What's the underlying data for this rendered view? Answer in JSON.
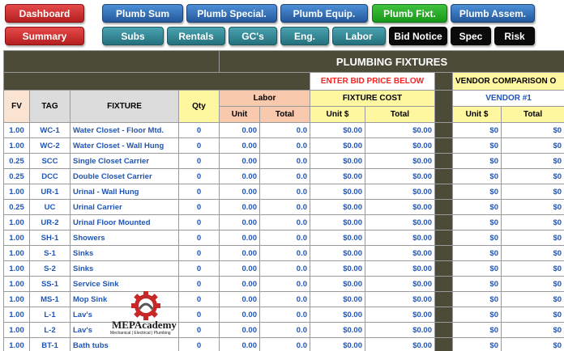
{
  "nav": {
    "row1": [
      "Dashboard",
      "Plumb Sum",
      "Plumb Special.",
      "Plumb Equip.",
      "Plumb Fixt.",
      "Plumb Assem."
    ],
    "row2": [
      "Summary",
      "Subs",
      "Rentals",
      "GC's",
      "Eng.",
      "Labor",
      "Bid Notice",
      "Spec",
      "Risk"
    ]
  },
  "sheet": {
    "title": "PLUMBING FIXTURES",
    "bid_note": "ENTER BID PRICE BELOW",
    "vendor_comparison": "VENDOR COMPARISON O",
    "headers": {
      "fv": "FV",
      "tag": "TAG",
      "fixture": "FIXTURE",
      "qty": "Qty",
      "labor": "Labor",
      "fixture_cost": "FIXTURE COST",
      "vendor1": "VENDOR #1",
      "unit": "Unit",
      "total": "Total",
      "unit_dollar": "Unit $",
      "total2": "Total",
      "unit_dollar_v": "Unit $",
      "total_v": "Total"
    },
    "rows": [
      {
        "fv": "1.00",
        "tag": "WC-1",
        "fixture": "Water Closet - Floor Mtd.",
        "qty": "0",
        "lunit": "0.00",
        "ltotal": "0.0",
        "funit": "$0.00",
        "ftotal": "$0.00",
        "vunit": "$0",
        "vtotal": "$0"
      },
      {
        "fv": "1.00",
        "tag": "WC-2",
        "fixture": "Water Closet - Wall Hung",
        "qty": "0",
        "lunit": "0.00",
        "ltotal": "0.0",
        "funit": "$0.00",
        "ftotal": "$0.00",
        "vunit": "$0",
        "vtotal": "$0"
      },
      {
        "fv": "0.25",
        "tag": "SCC",
        "fixture": "Single Closet Carrier",
        "qty": "0",
        "lunit": "0.00",
        "ltotal": "0.0",
        "funit": "$0.00",
        "ftotal": "$0.00",
        "vunit": "$0",
        "vtotal": "$0"
      },
      {
        "fv": "0.25",
        "tag": "DCC",
        "fixture": "Double Closet Carrier",
        "qty": "0",
        "lunit": "0.00",
        "ltotal": "0.0",
        "funit": "$0.00",
        "ftotal": "$0.00",
        "vunit": "$0",
        "vtotal": "$0"
      },
      {
        "fv": "1.00",
        "tag": "UR-1",
        "fixture": "Urinal - Wall Hung",
        "qty": "0",
        "lunit": "0.00",
        "ltotal": "0.0",
        "funit": "$0.00",
        "ftotal": "$0.00",
        "vunit": "$0",
        "vtotal": "$0"
      },
      {
        "fv": "0.25",
        "tag": "UC",
        "fixture": "Urinal Carrier",
        "qty": "0",
        "lunit": "0.00",
        "ltotal": "0.0",
        "funit": "$0.00",
        "ftotal": "$0.00",
        "vunit": "$0",
        "vtotal": "$0"
      },
      {
        "fv": "1.00",
        "tag": "UR-2",
        "fixture": "Urinal Floor Mounted",
        "qty": "0",
        "lunit": "0.00",
        "ltotal": "0.0",
        "funit": "$0.00",
        "ftotal": "$0.00",
        "vunit": "$0",
        "vtotal": "$0"
      },
      {
        "fv": "1.00",
        "tag": "SH-1",
        "fixture": "Showers",
        "qty": "0",
        "lunit": "0.00",
        "ltotal": "0.0",
        "funit": "$0.00",
        "ftotal": "$0.00",
        "vunit": "$0",
        "vtotal": "$0"
      },
      {
        "fv": "1.00",
        "tag": "S-1",
        "fixture": "Sinks",
        "qty": "0",
        "lunit": "0.00",
        "ltotal": "0.0",
        "funit": "$0.00",
        "ftotal": "$0.00",
        "vunit": "$0",
        "vtotal": "$0"
      },
      {
        "fv": "1.00",
        "tag": "S-2",
        "fixture": "Sinks",
        "qty": "0",
        "lunit": "0.00",
        "ltotal": "0.0",
        "funit": "$0.00",
        "ftotal": "$0.00",
        "vunit": "$0",
        "vtotal": "$0"
      },
      {
        "fv": "1.00",
        "tag": "SS-1",
        "fixture": "Service Sink",
        "qty": "0",
        "lunit": "0.00",
        "ltotal": "0.0",
        "funit": "$0.00",
        "ftotal": "$0.00",
        "vunit": "$0",
        "vtotal": "$0"
      },
      {
        "fv": "1.00",
        "tag": "MS-1",
        "fixture": "Mop Sink",
        "qty": "0",
        "lunit": "0.00",
        "ltotal": "0.0",
        "funit": "$0.00",
        "ftotal": "$0.00",
        "vunit": "$0",
        "vtotal": "$0"
      },
      {
        "fv": "1.00",
        "tag": "L-1",
        "fixture": "Lav's",
        "qty": "0",
        "lunit": "0.00",
        "ltotal": "0.0",
        "funit": "$0.00",
        "ftotal": "$0.00",
        "vunit": "$0",
        "vtotal": "$0"
      },
      {
        "fv": "1.00",
        "tag": "L-2",
        "fixture": "Lav's",
        "qty": "0",
        "lunit": "0.00",
        "ltotal": "0.0",
        "funit": "$0.00",
        "ftotal": "$0.00",
        "vunit": "$0",
        "vtotal": "$0"
      },
      {
        "fv": "1.00",
        "tag": "BT-1",
        "fixture": "Bath tubs",
        "qty": "0",
        "lunit": "0.00",
        "ltotal": "0.0",
        "funit": "$0.00",
        "ftotal": "$0.00",
        "vunit": "$0",
        "vtotal": "$0"
      }
    ]
  },
  "logo": {
    "name": "MEPAcademy",
    "tagline": "Mechanical | Electrical | Plumbing",
    "icon": "gear-icon"
  },
  "colors": {
    "header_dark": "#4b4b38",
    "link_blue": "#1f55b8",
    "accent_red": "#ff1f1f",
    "qty_yellow": "#fff7a0",
    "labor_peach": "#f8c9ad"
  }
}
